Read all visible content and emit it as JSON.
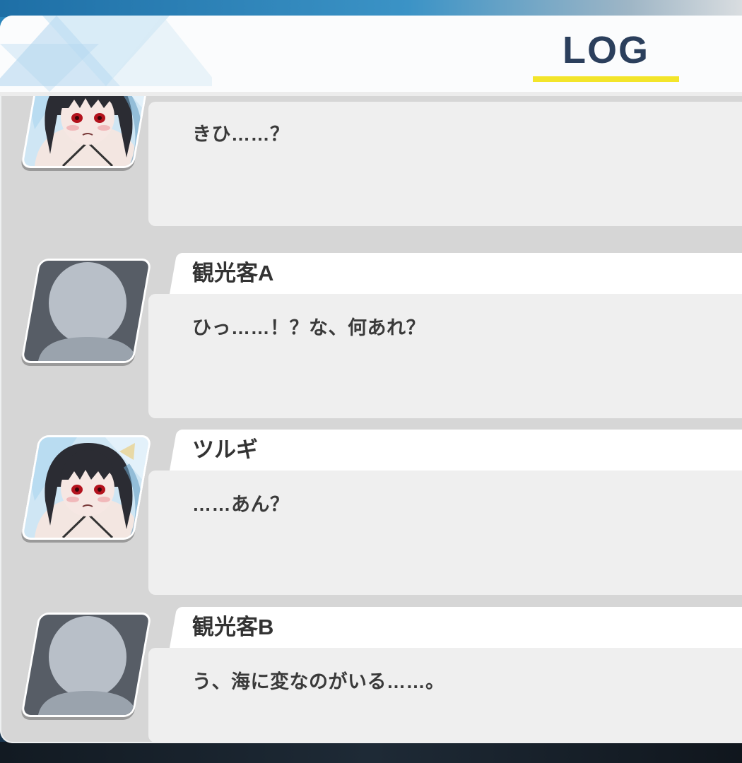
{
  "header": {
    "title": "LOG"
  },
  "colors": {
    "title": "#2b3f5c",
    "underline": "#f3e52a",
    "panel": "#d6d6d6",
    "message_box": "#efefef",
    "name_bar": "#ffffff"
  },
  "entries": [
    {
      "speaker": "",
      "message": "きひ……？",
      "avatar": "tsurugi-portrait-icon"
    },
    {
      "speaker": "観光客A",
      "message": "ひっ……！？な、何あれ？",
      "avatar": "silhouette-placeholder-icon"
    },
    {
      "speaker": "ツルギ",
      "message": "……あん？",
      "avatar": "tsurugi-portrait-icon"
    },
    {
      "speaker": "観光客B",
      "message": "う、海に変なのがいる……。",
      "avatar": "silhouette-placeholder-icon"
    }
  ]
}
